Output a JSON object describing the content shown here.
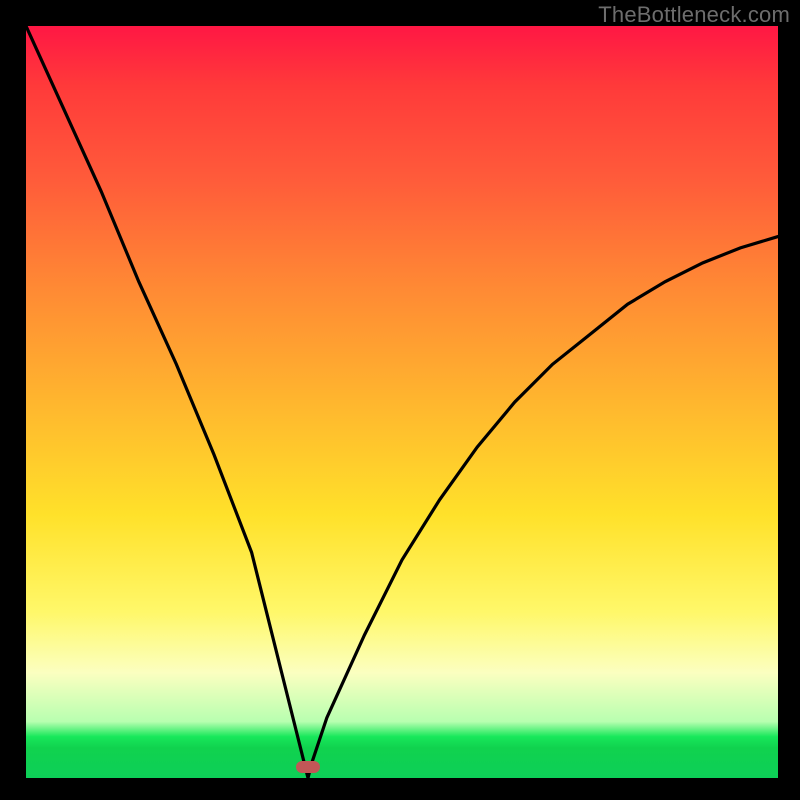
{
  "watermark": "TheBottleneck.com",
  "chart_data": {
    "type": "line",
    "title": "",
    "xlabel": "",
    "ylabel": "",
    "xlim": [
      0,
      100
    ],
    "ylim": [
      0,
      100
    ],
    "x": [
      0,
      5,
      10,
      15,
      20,
      25,
      30,
      32,
      34,
      36,
      37.5,
      38,
      40,
      45,
      50,
      55,
      60,
      65,
      70,
      75,
      80,
      85,
      90,
      95,
      100
    ],
    "values": [
      100,
      89,
      78,
      66,
      55,
      43,
      30,
      22,
      14,
      6,
      0,
      2,
      8,
      19,
      29,
      37,
      44,
      50,
      55,
      59,
      63,
      66,
      68.5,
      70.5,
      72
    ],
    "optimum_x": 37.5,
    "marker": {
      "x": 37.5,
      "y": 1.5
    },
    "gradient_stops": [
      {
        "pos": 0,
        "color": "#ff1744"
      },
      {
        "pos": 35,
        "color": "#ff8a34"
      },
      {
        "pos": 65,
        "color": "#ffe12a"
      },
      {
        "pos": 86,
        "color": "#fbffc0"
      },
      {
        "pos": 94,
        "color": "#18e85b"
      },
      {
        "pos": 100,
        "color": "#0dcf58"
      }
    ]
  }
}
